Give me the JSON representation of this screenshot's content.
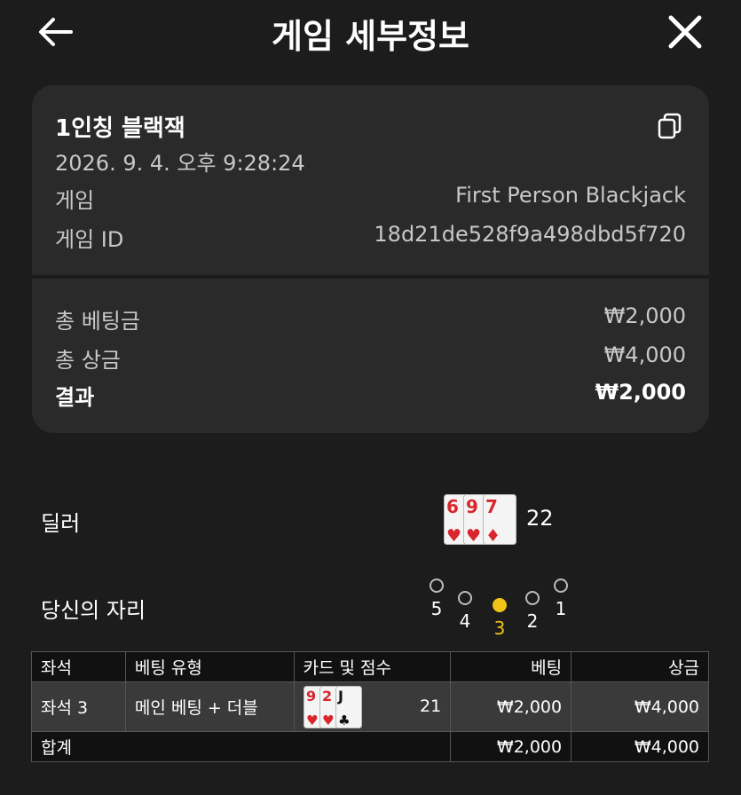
{
  "header": {
    "title": "게임 세부정보",
    "back_icon": "arrow-left-icon",
    "close_icon": "close-icon"
  },
  "summary": {
    "game_name": "1인칭 블랙잭",
    "datetime": "2026. 9. 4. 오후 9:28:24",
    "copy_icon": "copy-icon",
    "game_label": "게임",
    "game_value": "First Person Blackjack",
    "game_id_label": "게임 ID",
    "game_id_value": "18d21de528f9a498dbd5f720",
    "total_bet_label": "총 베팅금",
    "total_bet_value": "₩2,000",
    "total_win_label": "총 상금",
    "total_win_value": "₩4,000",
    "result_label": "결과",
    "result_value": "₩2,000"
  },
  "dealer": {
    "label": "딜러",
    "cards": [
      {
        "rank": "6",
        "suit": "♥"
      },
      {
        "rank": "9",
        "suit": "♥"
      },
      {
        "rank": "7",
        "suit": "♦"
      }
    ],
    "score": "22"
  },
  "seats": {
    "label": "당신의 자리",
    "items": [
      "5",
      "4",
      "3",
      "2",
      "1"
    ],
    "selected": "3"
  },
  "table": {
    "headers": [
      "좌석",
      "베팅 유형",
      "카드 및 점수",
      "베팅",
      "상금"
    ],
    "row": {
      "seat": "좌석 3",
      "bet_type": "메인 베팅 + 더블",
      "cards": [
        {
          "rank": "9",
          "suit": "♥"
        },
        {
          "rank": "2",
          "suit": "♥"
        },
        {
          "rank": "J",
          "suit": "♣"
        }
      ],
      "score": "21",
      "bet": "₩2,000",
      "win": "₩4,000"
    },
    "total": {
      "label": "합계",
      "bet": "₩2,000",
      "win": "₩4,000"
    }
  },
  "colors": {
    "background": "#1c1c1c",
    "card": "#2a2a2a",
    "accent": "#f2c317",
    "red_suit": "#d8262c"
  }
}
